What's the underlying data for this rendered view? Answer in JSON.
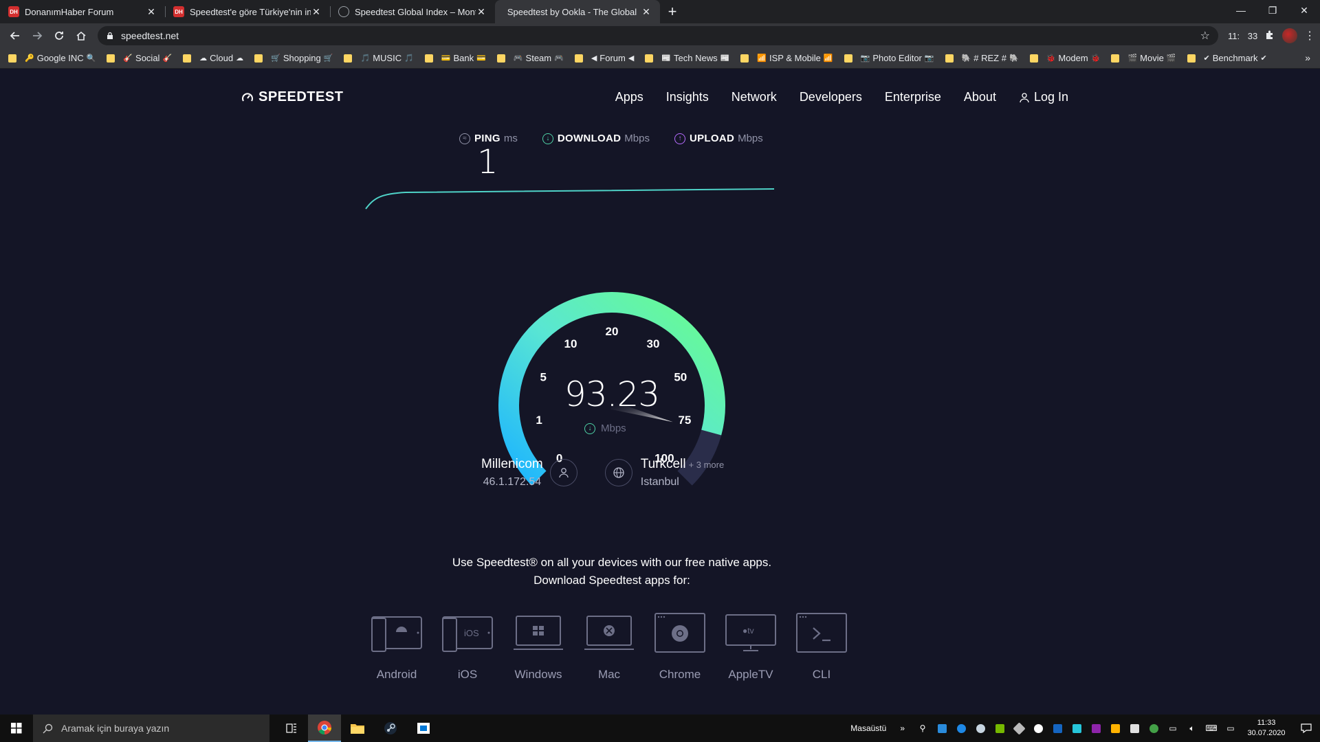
{
  "browser": {
    "tabs": [
      {
        "title": "DonanımHaber Forum",
        "favicon": "dh"
      },
      {
        "title": "Speedtest'e göre Türkiye'nin inte",
        "favicon": "dh"
      },
      {
        "title": "Speedtest Global Index – Monthl",
        "favicon": "ookla"
      },
      {
        "title": "Speedtest by Ookla - The Global",
        "favicon": "none",
        "active": true
      }
    ],
    "url": "speedtest.net",
    "clock_ext": {
      "hours": "11:",
      "minutes": "33"
    },
    "bookmarks": [
      {
        "label": "Google INC",
        "icon": "🔑",
        "tail": "🔍"
      },
      {
        "label": "Social",
        "icon": "🎸",
        "tail": "🎸"
      },
      {
        "label": "Cloud",
        "icon": "☁",
        "tail": "☁"
      },
      {
        "label": "Shopping",
        "icon": "🛒",
        "tail": "🛒"
      },
      {
        "label": "MUSIC",
        "icon": "🎵",
        "tail": "🎵"
      },
      {
        "label": "Bank",
        "icon": "💳",
        "tail": "💳"
      },
      {
        "label": "Steam",
        "icon": "🎮",
        "tail": "🎮"
      },
      {
        "label": "Forum",
        "icon": "◀",
        "tail": "◀"
      },
      {
        "label": "Tech News",
        "icon": "📰",
        "tail": "📰"
      },
      {
        "label": "ISP & Mobile",
        "icon": "📶",
        "tail": "📶"
      },
      {
        "label": "Photo Editor",
        "icon": "📷",
        "tail": "📷"
      },
      {
        "label": "# REZ #",
        "icon": "🐘",
        "tail": "🐘"
      },
      {
        "label": "Modem",
        "icon": "🐞",
        "tail": "🐞"
      },
      {
        "label": "Movie",
        "icon": "🎬",
        "tail": "🎬"
      },
      {
        "label": "Benchmark",
        "icon": "✔",
        "tail": "✔"
      }
    ]
  },
  "site": {
    "logo": "SPEEDTEST",
    "nav": [
      "Apps",
      "Insights",
      "Network",
      "Developers",
      "Enterprise",
      "About"
    ],
    "login": "Log In",
    "metrics": {
      "ping": {
        "label": "PING",
        "unit": "ms",
        "value": "1"
      },
      "download": {
        "label": "DOWNLOAD",
        "unit": "Mbps"
      },
      "upload": {
        "label": "UPLOAD",
        "unit": "Mbps"
      }
    },
    "gauge": {
      "ticks": [
        "0",
        "1",
        "5",
        "10",
        "20",
        "30",
        "50",
        "75",
        "100"
      ],
      "value": "93.23",
      "unit": "Mbps",
      "needle_fraction": 0.89
    },
    "isp": {
      "name": "Millenicom",
      "ip": "46.1.172.54"
    },
    "server": {
      "name": "Turkcell",
      "more": "+ 3 more",
      "city": "Istanbul"
    },
    "promo": {
      "line1": "Use Speedtest® on all your devices with our free native apps.",
      "line2": "Download Speedtest apps for:"
    },
    "apps": [
      "Android",
      "iOS",
      "Windows",
      "Mac",
      "Chrome",
      "AppleTV",
      "CLI"
    ]
  },
  "taskbar": {
    "search_placeholder": "Aramak için buraya yazın",
    "desktop_label": "Masaüstü",
    "time": "11:33",
    "date": "30.07.2020"
  },
  "colors": {
    "background": "#141526",
    "gauge_start": "#1cb4ff",
    "gauge_end": "#6afd8c",
    "download_accent": "#4fd3a7",
    "upload_accent": "#b66cff"
  }
}
